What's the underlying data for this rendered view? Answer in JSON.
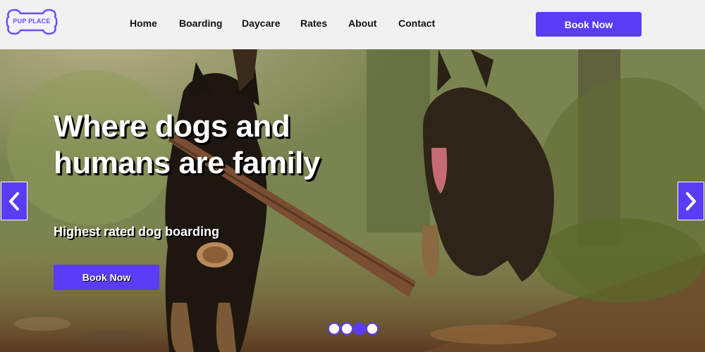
{
  "brand": {
    "logo_text": "PUP PLACE",
    "accent_color": "#5b3cf5",
    "logo_icon": "bone-icon"
  },
  "nav": {
    "items": [
      {
        "label": "Home"
      },
      {
        "label": "Boarding"
      },
      {
        "label": "Daycare"
      },
      {
        "label": "Rates"
      },
      {
        "label": "About"
      },
      {
        "label": "Contact"
      }
    ],
    "cta_label": "Book Now"
  },
  "hero": {
    "title": "Where dogs and humans are family",
    "subtitle": "Highest rated dog boarding",
    "cta_label": "Book Now",
    "image": "photo-two-german-shepherds-running-with-stick",
    "prev_icon": "chevron-left-icon",
    "next_icon": "chevron-right-icon"
  },
  "carousel": {
    "slide_count": 4,
    "active_index": 2
  }
}
